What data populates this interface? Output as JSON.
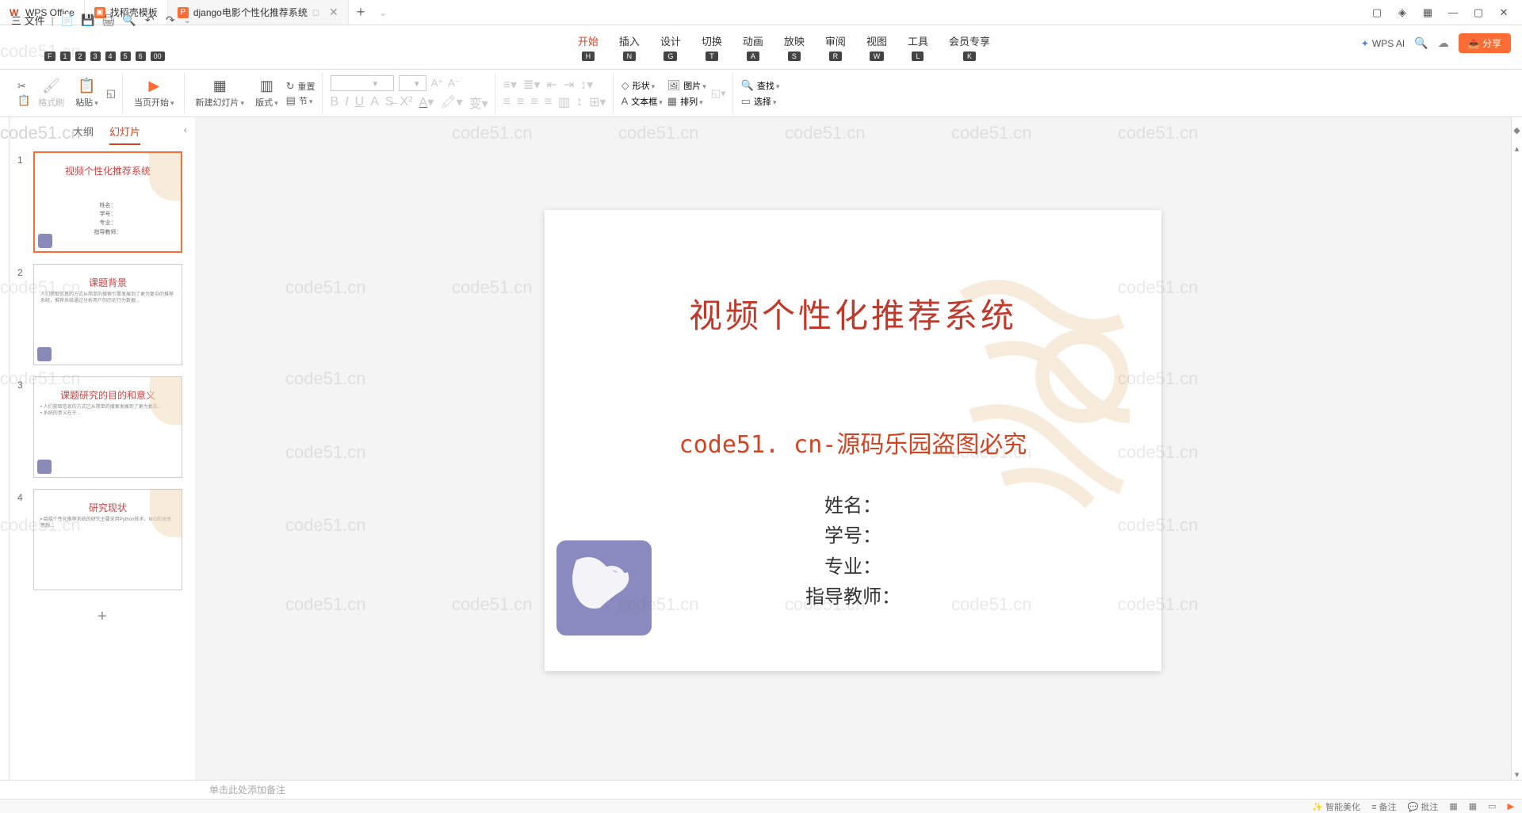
{
  "titlebar": {
    "tabs": [
      {
        "icon": "W",
        "label": "WPS Office",
        "color": "#d14424"
      },
      {
        "icon": "▣",
        "label": "找稻壳模板",
        "color": "#fd6c35"
      },
      {
        "icon": "P",
        "label": "django电影个性化推荐系统",
        "color": "#fd6c35"
      }
    ],
    "add": "+"
  },
  "window": {
    "icons": [
      "▢",
      "◇",
      "▣",
      "—",
      "▢",
      "✕"
    ]
  },
  "menubar": {
    "file": "三 文件",
    "qa_keys": [
      "F",
      "1",
      "2",
      "3",
      "4",
      "5",
      "6",
      "00"
    ],
    "tabs": [
      {
        "label": "开始",
        "key": "H",
        "active": true
      },
      {
        "label": "插入",
        "key": "N"
      },
      {
        "label": "设计",
        "key": "G"
      },
      {
        "label": "切换",
        "key": "T"
      },
      {
        "label": "动画",
        "key": "A"
      },
      {
        "label": "放映",
        "key": "S"
      },
      {
        "label": "审阅",
        "key": "R"
      },
      {
        "label": "视图",
        "key": "W"
      },
      {
        "label": "工具",
        "key": "L"
      },
      {
        "label": "会员专享",
        "key": "K"
      }
    ],
    "wps_ai": "WPS AI",
    "share": "分享"
  },
  "ribbon": {
    "format_painter": "格式刷",
    "paste": "粘贴",
    "start_current": "当页开始",
    "new_slide": "新建幻灯片",
    "layout": "版式",
    "section": "节",
    "reset": "重置",
    "shape": "形状",
    "image": "图片",
    "textbox": "文本框",
    "arrange": "排列",
    "find": "查找",
    "select": "选择"
  },
  "outline": {
    "tab_outline": "大纲",
    "tab_slides": "幻灯片",
    "thumbs": [
      {
        "num": "1",
        "title": "视频个性化推荐系统",
        "info": "姓名：\n学号：\n专业：\n指导教师："
      },
      {
        "num": "2",
        "title": "课题背景"
      },
      {
        "num": "3",
        "title": "课题研究的目的和意义"
      },
      {
        "num": "4",
        "title": "研究现状"
      }
    ]
  },
  "slide": {
    "title": "视频个性化推荐系统",
    "watermark": "code51. cn-源码乐园盗图必究",
    "info_name": "姓名：",
    "info_id": "学号：",
    "info_major": "专业：",
    "info_advisor": "指导教师："
  },
  "notes": "单击此处添加备注",
  "status": {
    "left": "",
    "right_items": [
      "智能美化",
      "备注",
      "批注"
    ]
  },
  "watermark_text": "code51.cn"
}
